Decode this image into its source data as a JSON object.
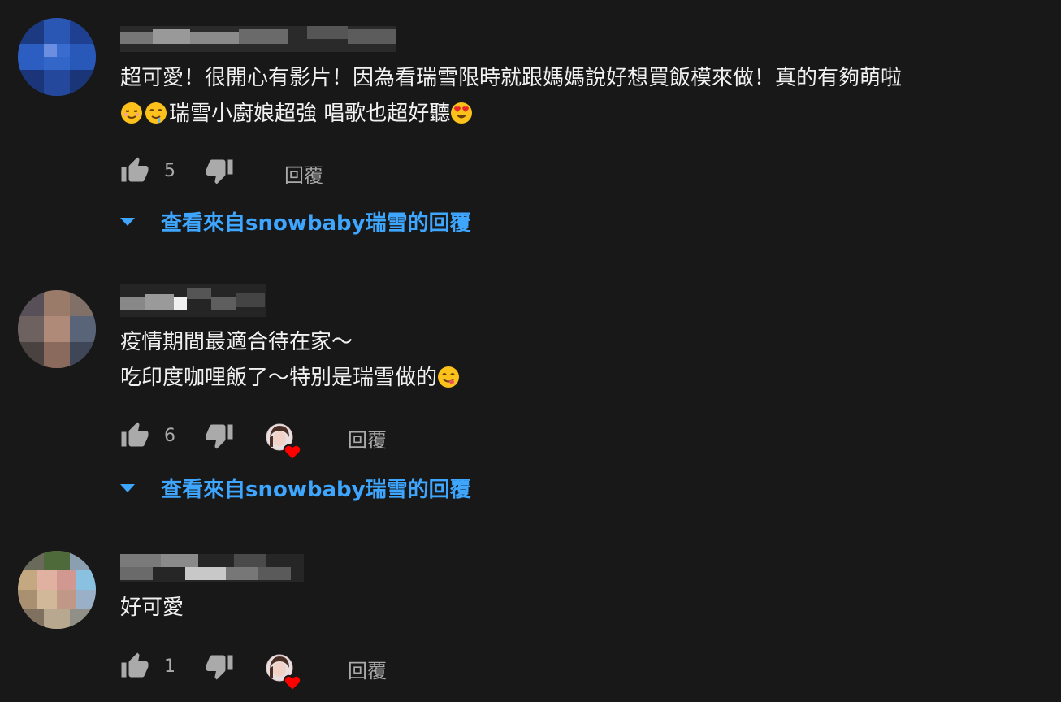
{
  "comments": [
    {
      "text_line1": "超可愛！很開心有影片！因為看瑞雪限時就跟媽媽說好想買飯模來做！真的有夠萌啦",
      "text_line2": "瑞雪小廚娘超強 唱歌也超好聽",
      "likes": "5",
      "reply_label": "回覆",
      "view_replies_label": "查看來自snowbaby瑞雪的回覆",
      "creator_hearted": false
    },
    {
      "text_line1": "疫情期間最適合待在家～",
      "text_line2": "吃印度咖哩飯了～特別是瑞雪做的",
      "likes": "6",
      "reply_label": "回覆",
      "view_replies_label": "查看來自snowbaby瑞雪的回覆",
      "creator_hearted": true
    },
    {
      "text_line1": "好可愛",
      "likes": "1",
      "reply_label": "回覆",
      "creator_hearted": true
    }
  ],
  "colors": {
    "background": "#181818",
    "text": "#f1f1f1",
    "secondary": "#aaaaaa",
    "link": "#3ea6ff",
    "heart": "#ff0000"
  }
}
